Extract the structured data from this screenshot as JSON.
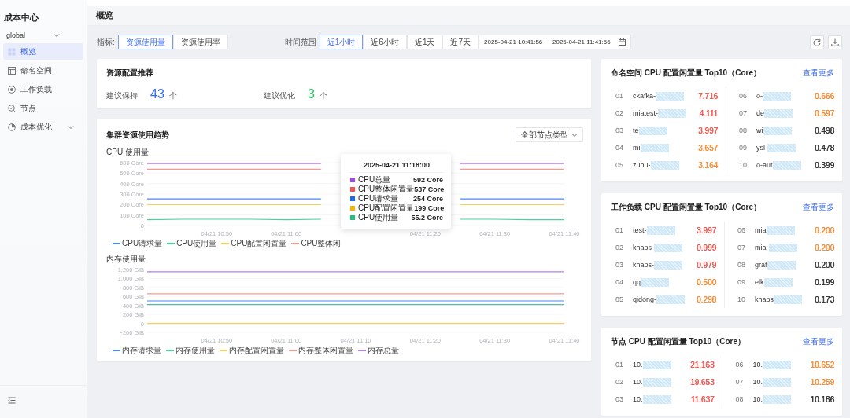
{
  "sidebar": {
    "title": "成本中心",
    "cluster_select": {
      "value": "global"
    },
    "items": [
      {
        "label": "概览",
        "selected": true
      },
      {
        "label": "命名空间",
        "selected": false
      },
      {
        "label": "工作负载",
        "selected": false
      },
      {
        "label": "节点",
        "selected": false
      },
      {
        "label": "成本优化",
        "selected": false,
        "expanded": false
      }
    ]
  },
  "header": {
    "title": "概览"
  },
  "toolbar": {
    "metric_label": "指标:",
    "metric_tabs": [
      {
        "label": "资源使用量",
        "selected": true
      },
      {
        "label": "资源使用率",
        "selected": false
      }
    ],
    "time_label": "时间范围",
    "time_tabs": [
      {
        "label": "近1小时",
        "selected": true
      },
      {
        "label": "近6小时",
        "selected": false
      },
      {
        "label": "近1天",
        "selected": false
      },
      {
        "label": "近7天",
        "selected": false
      }
    ],
    "date_range": {
      "start": "2025-04-21 10:41:56",
      "separator": "~",
      "end": "2025-04-21 11:41:56"
    }
  },
  "recommendation": {
    "title": "资源配置推荐",
    "stats": [
      {
        "label": "建议保持",
        "value": "43",
        "unit": "个",
        "color": "#2f6cf6"
      },
      {
        "label": "建议优化",
        "value": "3",
        "unit": "个",
        "color": "#22c55e"
      }
    ]
  },
  "trend": {
    "title": "集群资源使用趋势",
    "filter": "全部节点类型",
    "charts": [
      {
        "label": "CPU 使用量",
        "legend": [
          {
            "label": "CPU请求量",
            "color": "#4a86f7"
          },
          {
            "label": "CPU使用量",
            "color": "#4fd19a"
          },
          {
            "label": "CPU配置闲置量",
            "color": "#f8cf5c"
          },
          {
            "label": "CPU整体闲",
            "color": "#f79a92"
          }
        ],
        "chart_data": {
          "type": "line",
          "grid": true,
          "categories": [
            null,
            null,
            "04/21 10:50",
            null,
            "04/21 11:00",
            null,
            null,
            null,
            "04/21 11:20",
            null,
            "04/21 11:30",
            null,
            "04/21 11:40"
          ],
          "ylim": [
            0,
            600
          ],
          "yticks": [
            {
              "value": 0,
              "label": "0"
            },
            {
              "value": 100,
              "label": "100 Core"
            },
            {
              "value": 200,
              "label": "200 Core"
            },
            {
              "value": 300,
              "label": "300 Core"
            },
            {
              "value": 400,
              "label": "400 Core"
            },
            {
              "value": 500,
              "label": "500 Core"
            },
            {
              "value": 600,
              "label": "600 Core"
            }
          ],
          "series": [
            {
              "color": "#4a86f7",
              "values": [
                254,
                254,
                254,
                254,
                254,
                254,
                null,
                null,
                null,
                254,
                254,
                254,
                254
              ]
            },
            {
              "color": "#4fd19a",
              "values": [
                55,
                60,
                60,
                60,
                55,
                60,
                null,
                null,
                null,
                60,
                60,
                55,
                55
              ]
            },
            {
              "color": "#f8cf5c",
              "values": [
                199,
                199,
                199,
                199,
                199,
                199,
                null,
                null,
                null,
                199,
                199,
                199,
                199
              ]
            },
            {
              "color": "#f79a92",
              "values": [
                537,
                537,
                537,
                537,
                537,
                537,
                null,
                null,
                null,
                537,
                537,
                537,
                537
              ]
            },
            {
              "color": "#b57ef2",
              "values": [
                592,
                592,
                592,
                592,
                592,
                592,
                null,
                null,
                null,
                592,
                592,
                592,
                592
              ]
            }
          ]
        },
        "tooltip": {
          "title": "2025-04-21 11:18:00",
          "rows": [
            {
              "label": "CPU总量",
              "value": "592 Core",
              "color": "#9b4fe0"
            },
            {
              "label": "CPU整体闲置量",
              "value": "537 Core",
              "color": "#f5564f"
            },
            {
              "label": "CPU请求量",
              "value": "254 Core",
              "color": "#1f6bf2"
            },
            {
              "label": "CPU配置闲置量",
              "value": "199 Core",
              "color": "#f5b400"
            },
            {
              "label": "CPU使用量",
              "value": "55.2 Core",
              "color": "#22c07a"
            }
          ]
        }
      },
      {
        "label": "内存使用量",
        "legend": [
          {
            "label": "内存请求量",
            "color": "#4a86f7"
          },
          {
            "label": "内存使用量",
            "color": "#4fd19a"
          },
          {
            "label": "内存配置闲置量",
            "color": "#f8cf5c"
          },
          {
            "label": "内存整体闲置量",
            "color": "#f79a92"
          },
          {
            "label": "内存总量",
            "color": "#b57ef2"
          }
        ],
        "chart_data": {
          "type": "line",
          "grid": true,
          "categories": [
            null,
            null,
            "04/21 10:50",
            null,
            "04/21 11:00",
            null,
            "04/21 11:10",
            null,
            "04/21 11:20",
            null,
            "04/21 11:30",
            null,
            "04/21 11:40"
          ],
          "ylim": [
            -200,
            1200
          ],
          "yticks": [
            {
              "value": -200,
              "label": "−200 GiB"
            },
            {
              "value": 0,
              "label": "0"
            },
            {
              "value": 200,
              "label": "200 GiB"
            },
            {
              "value": 400,
              "label": "400 GiB"
            },
            {
              "value": 600,
              "label": "600 GiB"
            },
            {
              "value": 800,
              "label": "800 GiB"
            },
            {
              "value": 1000,
              "label": "1,000 GiB"
            },
            {
              "value": 1200,
              "label": "1,200 GiB"
            }
          ],
          "series": [
            {
              "color": "#4a86f7",
              "values": [
                500,
                500,
                500,
                500,
                500,
                500,
                500,
                500,
                500,
                500,
                500,
                500,
                500
              ]
            },
            {
              "color": "#4fc3b0",
              "values": [
                420,
                420,
                420,
                420,
                420,
                420,
                420,
                420,
                420,
                420,
                420,
                420,
                420
              ]
            },
            {
              "color": "#f8cf5c",
              "values": [
                0,
                0,
                0,
                0,
                0,
                0,
                0,
                0,
                0,
                0,
                0,
                0,
                0
              ]
            },
            {
              "color": "#f79a92",
              "values": [
                660,
                660,
                660,
                660,
                660,
                660,
                660,
                660,
                660,
                660,
                660,
                660,
                660
              ]
            },
            {
              "color": "#b57ef2",
              "values": [
                1150,
                1150,
                1150,
                1150,
                1150,
                1150,
                1150,
                1150,
                1150,
                1150,
                1150,
                1150,
                1150
              ]
            }
          ]
        }
      }
    ]
  },
  "rankings": [
    {
      "title": "命名空间 CPU 配置闲置量 Top10（Core）",
      "link": "查看更多",
      "columns": [
        [
          {
            "rank": "01",
            "name": "ckafka-",
            "masked": true,
            "value": "7.716",
            "color": "#f5564f"
          },
          {
            "rank": "02",
            "name": "miatest-",
            "masked": true,
            "value": "4.111",
            "color": "#f5564f"
          },
          {
            "rank": "03",
            "name": "te",
            "masked": true,
            "value": "3.997",
            "color": "#f5564f"
          },
          {
            "rank": "04",
            "name": "mi",
            "masked": true,
            "value": "3.657",
            "color": "#fa8c35"
          },
          {
            "rank": "05",
            "name": "zuhu-",
            "masked": true,
            "value": "3.164",
            "color": "#fa8c35"
          }
        ],
        [
          {
            "rank": "06",
            "name": "o-",
            "masked": true,
            "value": "0.666",
            "color": "#fa8c35"
          },
          {
            "rank": "07",
            "name": "de",
            "masked": true,
            "value": "0.597",
            "color": "#fa8c35"
          },
          {
            "rank": "08",
            "name": "wi",
            "masked": true,
            "value": "0.498",
            "color": "#333333"
          },
          {
            "rank": "09",
            "name": "ysl-",
            "masked": true,
            "value": "0.478",
            "color": "#333333"
          },
          {
            "rank": "10",
            "name": "o-aut",
            "masked": true,
            "value": "0.399",
            "color": "#333333"
          }
        ]
      ]
    },
    {
      "title": "工作负载 CPU 配置闲置量 Top10（Core）",
      "link": "查看更多",
      "columns": [
        [
          {
            "rank": "01",
            "name": "test-",
            "masked": true,
            "value": "3.997",
            "color": "#f5564f"
          },
          {
            "rank": "02",
            "name": "khaos-",
            "masked": true,
            "value": "0.999",
            "color": "#f5564f"
          },
          {
            "rank": "03",
            "name": "khaos-",
            "masked": true,
            "value": "0.979",
            "color": "#f5564f"
          },
          {
            "rank": "04",
            "name": "qq",
            "masked": true,
            "value": "0.500",
            "color": "#fa8c35"
          },
          {
            "rank": "05",
            "name": "qidong-",
            "masked": true,
            "value": "0.298",
            "color": "#fa8c35"
          }
        ],
        [
          {
            "rank": "06",
            "name": "mia",
            "masked": true,
            "value": "0.200",
            "color": "#fa8c35"
          },
          {
            "rank": "07",
            "name": "mia-",
            "masked": true,
            "value": "0.200",
            "color": "#fa8c35"
          },
          {
            "rank": "08",
            "name": "graf",
            "masked": true,
            "value": "0.200",
            "color": "#333333"
          },
          {
            "rank": "09",
            "name": "elk",
            "masked": true,
            "value": "0.199",
            "color": "#333333"
          },
          {
            "rank": "10",
            "name": "khaos",
            "masked": true,
            "value": "0.173",
            "color": "#333333"
          }
        ]
      ]
    },
    {
      "title": "节点 CPU 配置闲置量 Top10（Core）",
      "link": "查看更多",
      "columns": [
        [
          {
            "rank": "01",
            "name": "10.",
            "masked": true,
            "value": "21.163",
            "color": "#f5564f"
          },
          {
            "rank": "02",
            "name": "10.",
            "masked": true,
            "value": "19.653",
            "color": "#f5564f"
          },
          {
            "rank": "03",
            "name": "10.",
            "masked": true,
            "value": "11.637",
            "color": "#f5564f"
          }
        ],
        [
          {
            "rank": "06",
            "name": "10.",
            "masked": true,
            "value": "10.652",
            "color": "#fa8c35"
          },
          {
            "rank": "07",
            "name": "10.",
            "masked": true,
            "value": "10.259",
            "color": "#fa8c35"
          },
          {
            "rank": "08",
            "name": "10.",
            "masked": true,
            "value": "10.186",
            "color": "#333333"
          }
        ]
      ]
    }
  ]
}
